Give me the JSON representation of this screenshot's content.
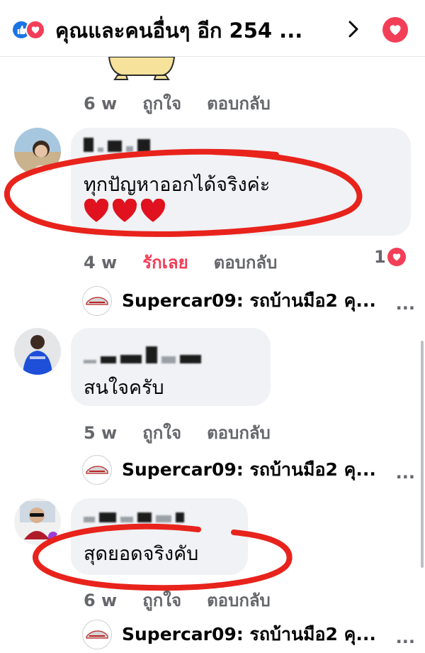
{
  "header": {
    "title": "คุณและคนอื่นๆ อีก 254 ..."
  },
  "top_comment": {
    "time": "6 w",
    "like": "ถูกใจ",
    "reply": "ตอบกลับ"
  },
  "comments": [
    {
      "text": "ทุกปัญหาออกได้จริงค่ะ",
      "time": "4 w",
      "like": "รักเลย",
      "reply": "ตอบกลับ",
      "reaction_count": "1",
      "reply_preview": "Supercar09: รถบ้านมือ2 คุ...",
      "more": "..."
    },
    {
      "text": "สนใจครับ",
      "time": "5 w",
      "like": "ถูกใจ",
      "reply": "ตอบกลับ",
      "reply_preview": "Supercar09: รถบ้านมือ2 คุ...",
      "more": "..."
    },
    {
      "text": "สุดยอดจริงคับ",
      "time": "6 w",
      "like": "ถูกใจ",
      "reply": "ตอบกลับ",
      "reply_preview": "Supercar09: รถบ้านมือ2 คุ...",
      "more": "..."
    }
  ],
  "colors": {
    "love": "#f33e58",
    "like": "#1b74e4",
    "annotation": "#e8231c"
  }
}
